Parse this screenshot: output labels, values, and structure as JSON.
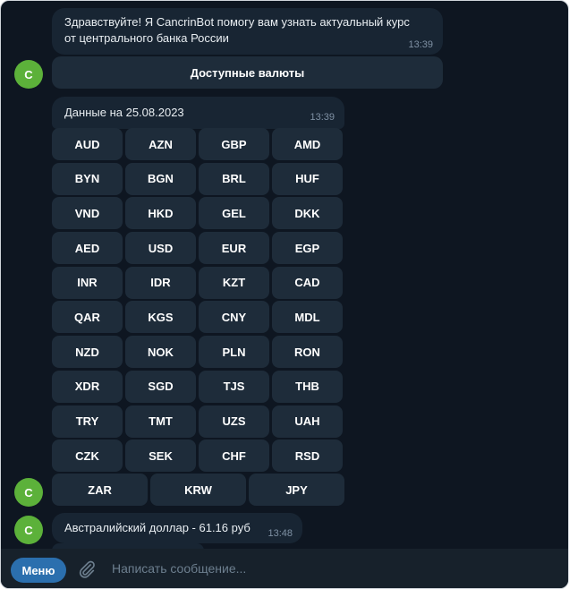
{
  "avatar_letter": "C",
  "messages": {
    "welcome": {
      "text": "Здравствуйте! Я CancrinBot помогу вам узнать актуальный курс от центрального банка России",
      "time": "13:39",
      "button": "Доступные валюты"
    },
    "currencies": {
      "text": "Данные на 25.08.2023",
      "time": "13:39",
      "rows": [
        [
          "AUD",
          "AZN",
          "GBP",
          "AMD"
        ],
        [
          "BYN",
          "BGN",
          "BRL",
          "HUF"
        ],
        [
          "VND",
          "HKD",
          "GEL",
          "DKK"
        ],
        [
          "AED",
          "USD",
          "EUR",
          "EGP"
        ],
        [
          "INR",
          "IDR",
          "KZT",
          "CAD"
        ],
        [
          "QAR",
          "KGS",
          "CNY",
          "MDL"
        ],
        [
          "NZD",
          "NOK",
          "PLN",
          "RON"
        ],
        [
          "XDR",
          "SGD",
          "TJS",
          "THB"
        ],
        [
          "TRY",
          "TMT",
          "UZS",
          "UAH"
        ],
        [
          "CZK",
          "SEK",
          "CHF",
          "RSD"
        ]
      ],
      "last_row": [
        "ZAR",
        "KRW",
        "JPY"
      ]
    },
    "rate": {
      "text": "Австралийский доллар - 61.16 руб",
      "time": "13:48"
    }
  },
  "bottom_bar": {
    "menu_label": "Меню",
    "input_placeholder": "Написать сообщение...",
    "attach_icon": "paperclip-icon"
  },
  "colors": {
    "background": "#0e1621",
    "bubble": "#182533",
    "button": "#1e2c3a",
    "avatar": "#5cb13a",
    "menu_button": "#2b6fae"
  }
}
